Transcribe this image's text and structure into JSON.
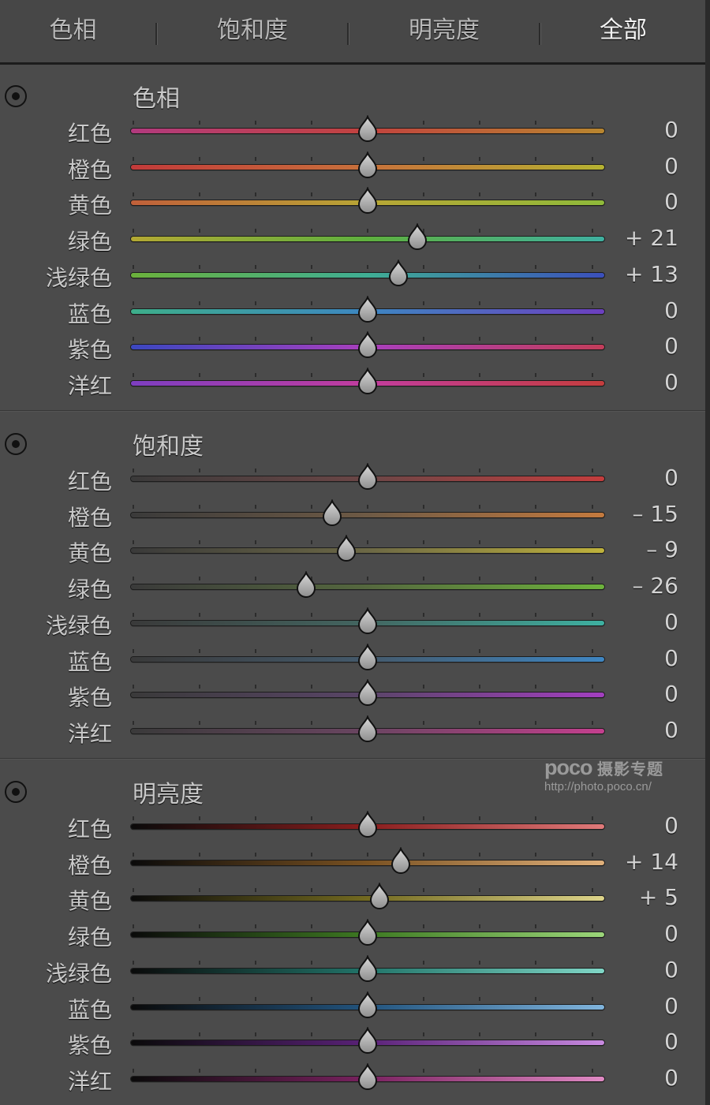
{
  "tabs": [
    {
      "label": "色相",
      "active": false
    },
    {
      "label": "饱和度",
      "active": false
    },
    {
      "label": "明亮度",
      "active": false
    },
    {
      "label": "全部",
      "active": true
    }
  ],
  "sections": [
    {
      "id": "hue",
      "title": "色相",
      "range": [
        -100,
        100
      ],
      "rows": [
        {
          "label": "红色",
          "value": 0,
          "display": "0",
          "colors": [
            "#b23a7e",
            "#c2433e",
            "#b8862f"
          ]
        },
        {
          "label": "橙色",
          "value": 0,
          "display": "0",
          "colors": [
            "#c23a3a",
            "#c7713b",
            "#b5b231"
          ]
        },
        {
          "label": "黄色",
          "value": 0,
          "display": "0",
          "colors": [
            "#c1603a",
            "#b8a635",
            "#8fba3a"
          ]
        },
        {
          "label": "绿色",
          "value": 21,
          "display": "+ 21",
          "colors": [
            "#b3a833",
            "#5eb03e",
            "#3fb0a0"
          ]
        },
        {
          "label": "浅绿色",
          "value": 13,
          "display": "+ 13",
          "colors": [
            "#6bb13b",
            "#3fae94",
            "#3b4fbc"
          ]
        },
        {
          "label": "蓝色",
          "value": 0,
          "display": "0",
          "colors": [
            "#3dae8a",
            "#3d86c1",
            "#6c3fbf"
          ]
        },
        {
          "label": "紫色",
          "value": 0,
          "display": "0",
          "colors": [
            "#3b47c0",
            "#a93fbd",
            "#c23d5a"
          ]
        },
        {
          "label": "洋红",
          "value": 0,
          "display": "0",
          "colors": [
            "#7d3ec1",
            "#c23d9e",
            "#c43d3d"
          ]
        }
      ]
    },
    {
      "id": "saturation",
      "title": "饱和度",
      "range": [
        -100,
        100
      ],
      "rows": [
        {
          "label": "红色",
          "value": 0,
          "display": "0",
          "colors": [
            "#3a3a3a",
            "#6b4646",
            "#c43d3d"
          ]
        },
        {
          "label": "橙色",
          "value": -15,
          "display": "– 15",
          "colors": [
            "#3a3a3a",
            "#6e5a45",
            "#c47a3e"
          ]
        },
        {
          "label": "黄色",
          "value": -9,
          "display": "– 9",
          "colors": [
            "#3a3a3a",
            "#6c6845",
            "#bfb23c"
          ]
        },
        {
          "label": "绿色",
          "value": -26,
          "display": "– 26",
          "colors": [
            "#3a3a3a",
            "#55683e",
            "#6db33c"
          ]
        },
        {
          "label": "浅绿色",
          "value": 0,
          "display": "0",
          "colors": [
            "#3a3a3a",
            "#436661",
            "#3eb0a1"
          ]
        },
        {
          "label": "蓝色",
          "value": 0,
          "display": "0",
          "colors": [
            "#3a3a3a",
            "#445a6c",
            "#3f86c2"
          ]
        },
        {
          "label": "紫色",
          "value": 0,
          "display": "0",
          "colors": [
            "#3a3a3a",
            "#5a4568",
            "#a33fc0"
          ]
        },
        {
          "label": "洋红",
          "value": 0,
          "display": "0",
          "colors": [
            "#3a3a3a",
            "#6a4561",
            "#c43f8e"
          ]
        }
      ]
    },
    {
      "id": "luminance",
      "title": "明亮度",
      "range": [
        -100,
        100
      ],
      "rows": [
        {
          "label": "红色",
          "value": 0,
          "display": "0",
          "colors": [
            "#0a0a0a",
            "#8a1e1e",
            "#e07a7a"
          ]
        },
        {
          "label": "橙色",
          "value": 14,
          "display": "+ 14",
          "colors": [
            "#0a0a0a",
            "#7a5222",
            "#e0b07a"
          ]
        },
        {
          "label": "黄色",
          "value": 5,
          "display": "+ 5",
          "colors": [
            "#0a0a0a",
            "#736a20",
            "#ddd48a"
          ]
        },
        {
          "label": "绿色",
          "value": 0,
          "display": "0",
          "colors": [
            "#0a0a0a",
            "#3e7a22",
            "#9cd67a"
          ]
        },
        {
          "label": "浅绿色",
          "value": 0,
          "display": "0",
          "colors": [
            "#0a0a0a",
            "#22756a",
            "#80d6c6"
          ]
        },
        {
          "label": "蓝色",
          "value": 0,
          "display": "0",
          "colors": [
            "#0a0a0a",
            "#22547e",
            "#80b4dc"
          ]
        },
        {
          "label": "紫色",
          "value": 0,
          "display": "0",
          "colors": [
            "#0a0a0a",
            "#5a2278",
            "#c88ae0"
          ]
        },
        {
          "label": "洋红",
          "value": 0,
          "display": "0",
          "colors": [
            "#0a0a0a",
            "#7a2260",
            "#e08ac4"
          ]
        }
      ]
    }
  ],
  "watermark": {
    "logo": "POCO",
    "cn": "摄影专题",
    "url": "http://photo.poco.cn/"
  }
}
